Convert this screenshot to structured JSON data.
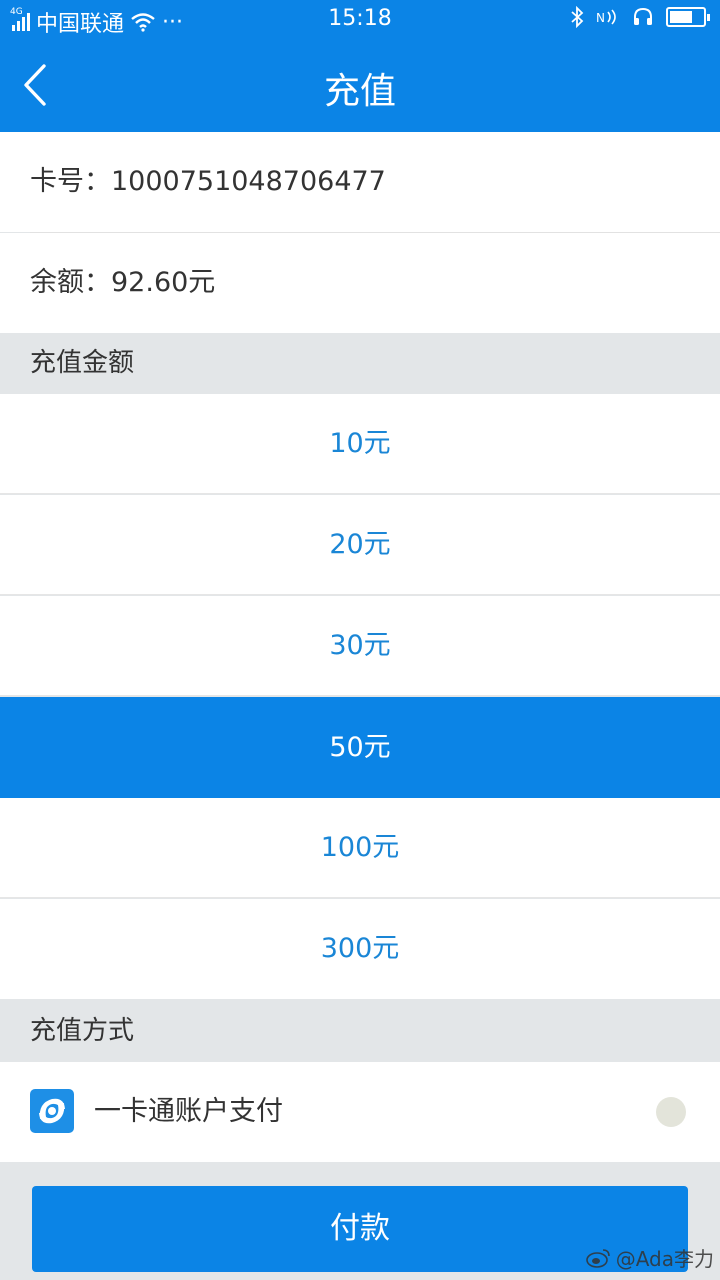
{
  "status_bar": {
    "network": "4G",
    "carrier": "中国联通",
    "more": "···",
    "time": "15:18",
    "battery_level": 0.7
  },
  "nav": {
    "title": "充值"
  },
  "card": {
    "number_label": "卡号：",
    "number": "1000751048706477"
  },
  "balance": {
    "label": "余额：",
    "value": "92.60元"
  },
  "amount_section": {
    "title": "充值金额",
    "options": [
      "10元",
      "20元",
      "30元",
      "50元",
      "100元",
      "300元"
    ],
    "selected_index": 3
  },
  "method_section": {
    "title": "充值方式",
    "method_label": "一卡通账户支付"
  },
  "pay_button": {
    "label": "付款"
  },
  "watermark": {
    "text": "@Ada李力"
  },
  "colors": {
    "primary": "#0b84e6",
    "amount_text": "#1a86d6",
    "section_bg": "#e3e6e8"
  }
}
